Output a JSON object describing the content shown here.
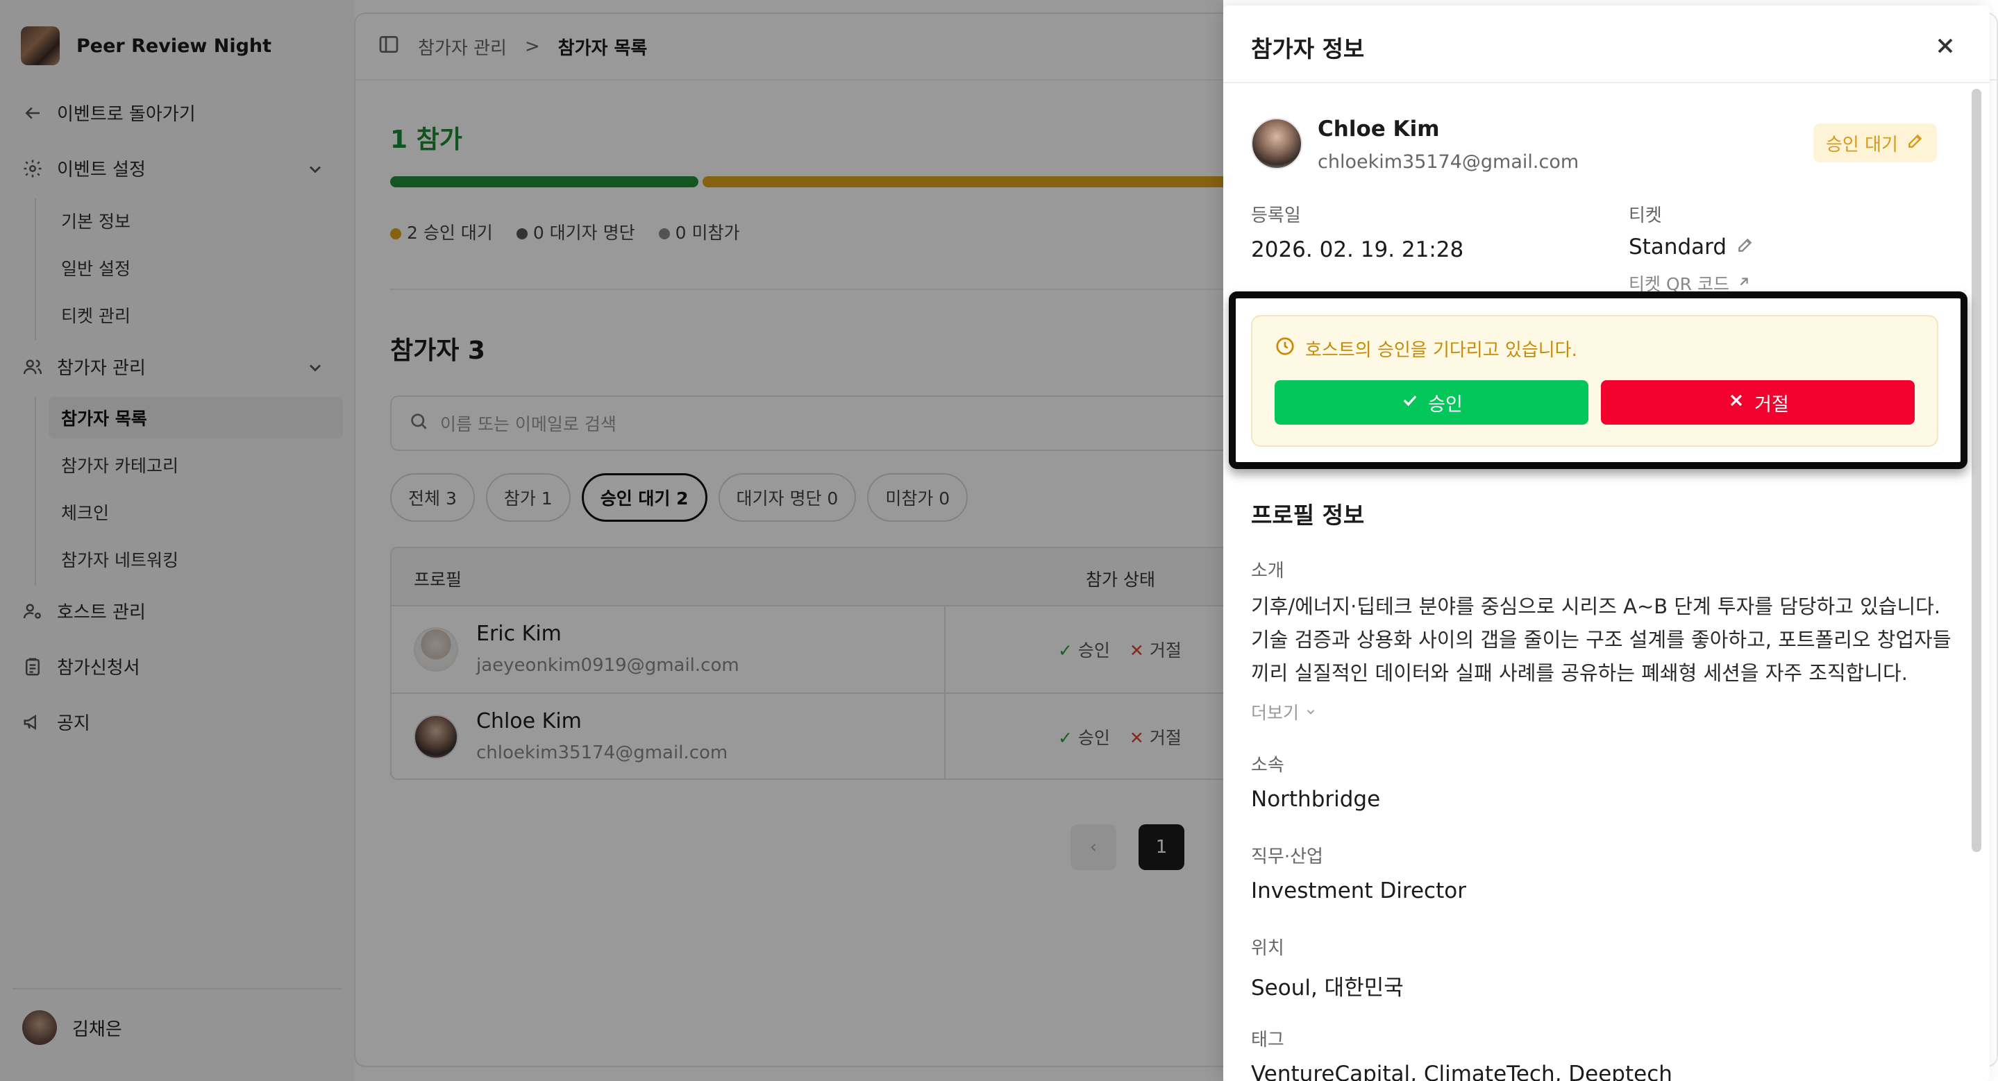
{
  "sidebar": {
    "brand": "Peer Review Night",
    "back": "이벤트로 돌아가기",
    "event_settings": "이벤트 설정",
    "event_sub": [
      "기본 정보",
      "일반 설정",
      "티켓 관리"
    ],
    "participants": "참가자 관리",
    "participants_sub": [
      "참가자 목록",
      "참가자 카테고리",
      "체크인",
      "참가자 네트워킹"
    ],
    "hosts": "호스트 관리",
    "applications": "참가신청서",
    "notice": "공지",
    "user_name": "김채은"
  },
  "topbar": {
    "crumb_parent": "참가자 관리",
    "crumb_sep": ">",
    "crumb_current": "참가자 목록"
  },
  "summary": {
    "title": "1 참가",
    "legend": [
      {
        "label": "2 승인 대기",
        "color": "#e0a21a"
      },
      {
        "label": "0 대기자 명단",
        "color": "#555555"
      },
      {
        "label": "0 미참가",
        "color": "#8a8a8a"
      }
    ],
    "progress": [
      {
        "fraction": 0.333,
        "color": "#1e8f3a"
      },
      {
        "fraction": 0.667,
        "color": "#e0a21a"
      }
    ]
  },
  "list": {
    "title": "참가자 3",
    "search_placeholder": "이름 또는 이메일로 검색",
    "filters": [
      {
        "label": "전체 3",
        "active": false
      },
      {
        "label": "참가 1",
        "active": false
      },
      {
        "label": "승인 대기 2",
        "active": true
      },
      {
        "label": "대기자 명단 0",
        "active": false
      },
      {
        "label": "미참가 0",
        "active": false
      }
    ],
    "col_profile": "프로필",
    "col_status": "참가 상태",
    "rows": [
      {
        "name": "Eric Kim",
        "email": "jaeyeonkim0919@gmail.com",
        "approve": "승인",
        "reject": "거절"
      },
      {
        "name": "Chloe Kim",
        "email": "chloekim35174@gmail.com",
        "approve": "승인",
        "reject": "거절"
      }
    ],
    "page_current": "1"
  },
  "drawer": {
    "title": "참가자 정보",
    "name": "Chloe Kim",
    "email": "chloekim35174@gmail.com",
    "status_badge": "승인 대기",
    "registered_label": "등록일",
    "registered_value": "2026. 02. 19. 21:28",
    "ticket_label": "티켓",
    "ticket_value": "Standard",
    "qr_link": "티켓 QR 코드",
    "pending_message": "호스트의 승인을 기다리고 있습니다.",
    "approve_label": "승인",
    "reject_label": "거절",
    "profile_title": "프로필 정보",
    "intro_label": "소개",
    "intro_text": "기후/에너지·딥테크 분야를 중심으로 시리즈 A~B 단계 투자를 담당하고 있습니다. 기술 검증과 상용화 사이의 갭을 줄이는 구조 설계를 좋아하고, 포트폴리오 창업자들끼리 실질적인 데이터와 실패 사례를 공유하는 폐쇄형 세션을 자주 조직합니다.",
    "more": "더보기",
    "affiliation_label": "소속",
    "affiliation_value": "Northbridge",
    "job_label": "직무·산업",
    "job_value": "Investment Director",
    "location_label": "위치",
    "location_value": "Seoul, 대한민국",
    "tags_label": "태그",
    "tags_value": "VentureCapital, ClimateTech, Deeptech"
  }
}
